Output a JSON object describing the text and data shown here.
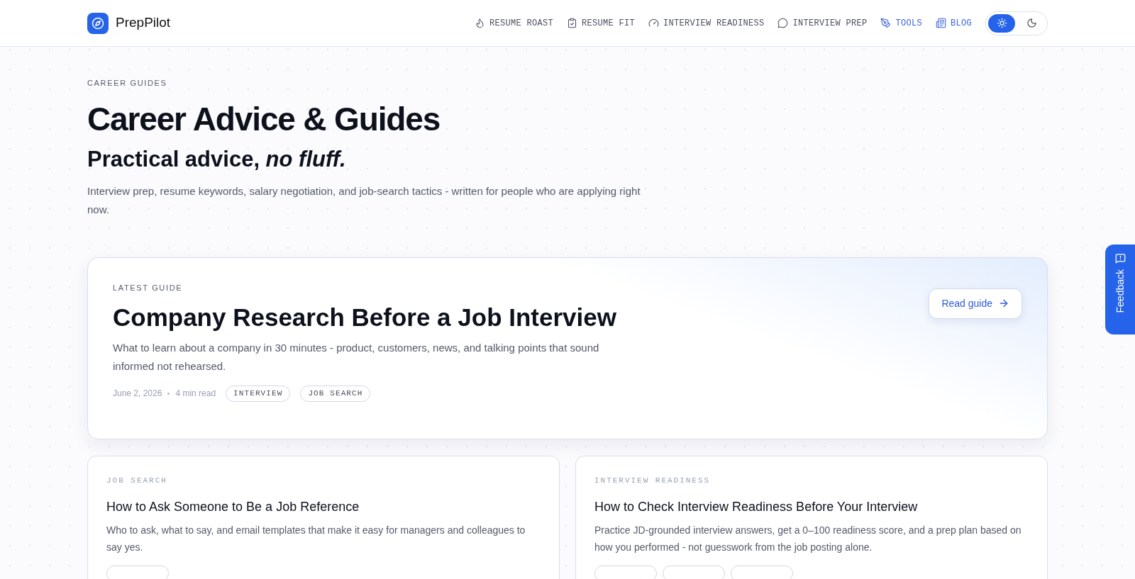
{
  "brand": {
    "name": "PrepPilot"
  },
  "nav": [
    {
      "label": "RESUME ROAST",
      "kind": "flame",
      "highlighted": false
    },
    {
      "label": "RESUME FIT",
      "kind": "clipboard",
      "highlighted": false
    },
    {
      "label": "INTERVIEW READINESS",
      "kind": "gauge",
      "highlighted": false
    },
    {
      "label": "INTERVIEW PREP",
      "kind": "chat",
      "highlighted": false
    },
    {
      "label": "TOOLS",
      "kind": "tools",
      "highlighted": true
    },
    {
      "label": "BLOG",
      "kind": "list",
      "highlighted": true
    }
  ],
  "theme_toggle": [
    {
      "kind": "light",
      "selected": true
    },
    {
      "kind": "dark",
      "selected": false
    }
  ],
  "hero": {
    "eyebrow": "CAREER GUIDES",
    "title": "Career Advice & Guides",
    "subtitle": "Practical advice, *no fluff.*",
    "description": "Interview prep, resume keywords, salary negotiation, and job-search tactics - written for people who are applying right now."
  },
  "featured": {
    "eyebrow": "LATEST GUIDE",
    "title": "Company Research Before a Job Interview",
    "description": "What to learn about a company in 30 minutes - product, customers, news, and talking points that sound informed not rehearsed.",
    "date": "June 2, 2026",
    "read_time": "4 min read",
    "tags": [
      "INTERVIEW",
      "JOB SEARCH"
    ],
    "button": "Read guide"
  },
  "cards": [
    {
      "category": "JOB SEARCH",
      "title": "How to Ask Someone to Be a Job Reference",
      "description": "Who to ask, what to say, and email templates that make it easy for managers and colleagues to say yes.",
      "tags": [
        {
          "kind": "cut"
        }
      ]
    },
    {
      "category": "INTERVIEW READINESS",
      "title": "How to Check Interview Readiness Before Your Interview",
      "description": "Practice JD-grounded interview answers, get a 0–100 readiness score, and a prep plan based on how you performed - not guesswork from the job posting alone.",
      "tags": [
        {
          "kind": "cut"
        },
        {
          "kind": "cut"
        },
        {
          "kind": "cut"
        }
      ]
    }
  ],
  "feedback": {
    "label": "Feedback"
  }
}
